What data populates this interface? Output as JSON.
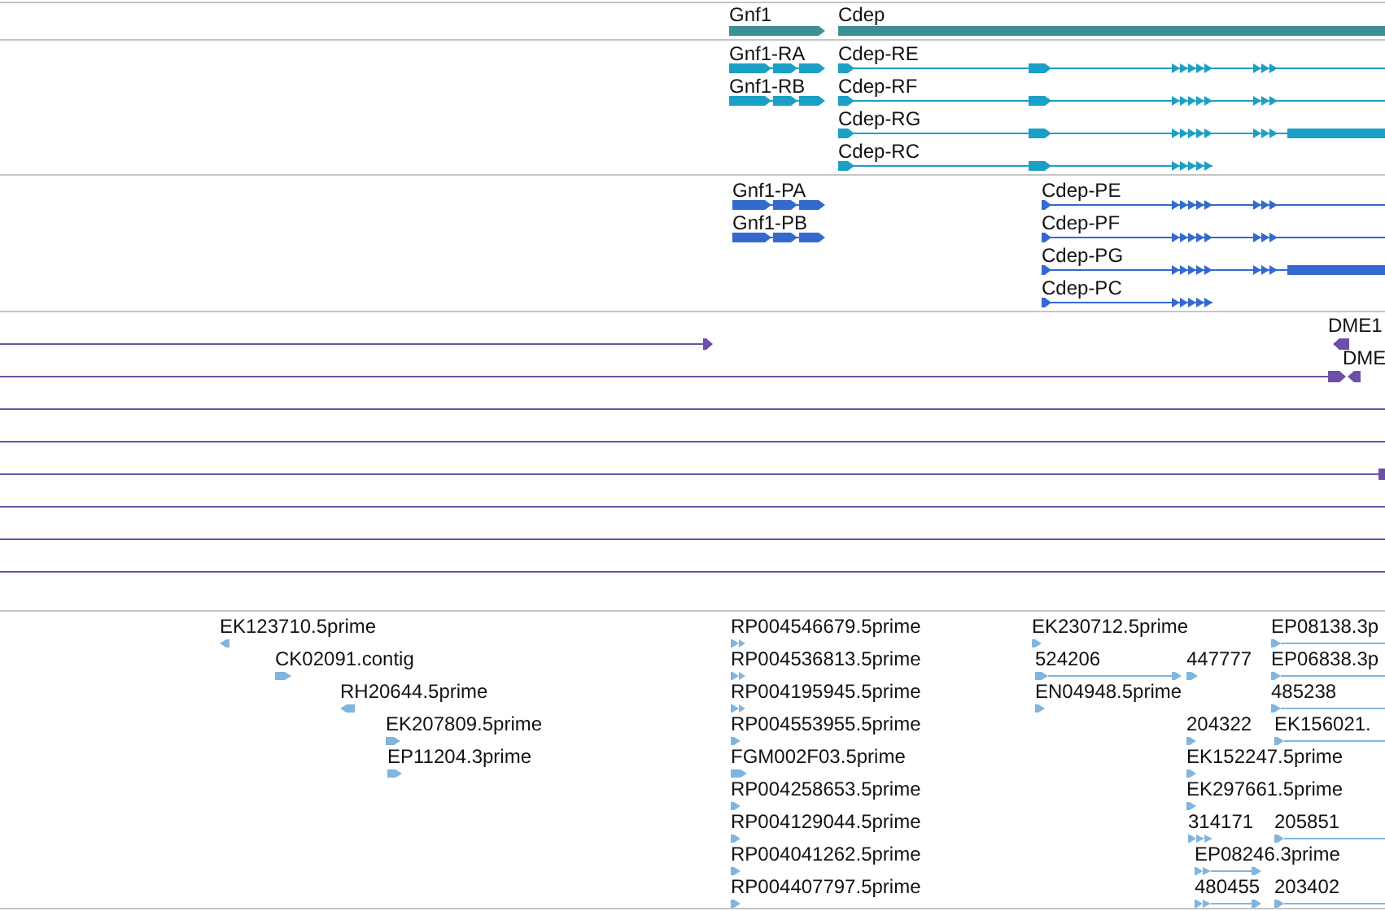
{
  "tracks": [
    {
      "kind": "gene",
      "features": [
        {
          "label": "Gnf1"
        },
        {
          "label": "Cdep"
        }
      ]
    },
    {
      "kind": "transcript",
      "features": [
        {
          "label": "Gnf1-RA"
        },
        {
          "label": "Gnf1-RB"
        },
        {
          "label": "Cdep-RE"
        },
        {
          "label": "Cdep-RF"
        },
        {
          "label": "Cdep-RG"
        },
        {
          "label": "Cdep-RC"
        }
      ]
    },
    {
      "kind": "protein",
      "features": [
        {
          "label": "Gnf1-PA"
        },
        {
          "label": "Gnf1-PB"
        },
        {
          "label": "Cdep-PE"
        },
        {
          "label": "Cdep-PF"
        },
        {
          "label": "Cdep-PG"
        },
        {
          "label": "Cdep-PC"
        }
      ]
    },
    {
      "kind": "alignment",
      "features": [
        {
          "label": "DME1"
        },
        {
          "label": "DME"
        }
      ]
    },
    {
      "kind": "est",
      "features": [
        {
          "label": "EK123710.5prime",
          "reverse": true
        },
        {
          "label": "CK02091.contig",
          "reverse": false
        },
        {
          "label": "RH20644.5prime",
          "reverse": true
        },
        {
          "label": "EK207809.5prime",
          "reverse": false
        },
        {
          "label": "EP11204.3prime",
          "reverse": false
        },
        {
          "label": "RP004546679.5prime",
          "reverse": false
        },
        {
          "label": "RP004536813.5prime",
          "reverse": false
        },
        {
          "label": "RP004195945.5prime",
          "reverse": false
        },
        {
          "label": "RP004553955.5prime",
          "reverse": false
        },
        {
          "label": "FGM002F03.5prime",
          "reverse": false
        },
        {
          "label": "RP004258653.5prime",
          "reverse": false
        },
        {
          "label": "RP004129044.5prime",
          "reverse": false
        },
        {
          "label": "RP004041262.5prime",
          "reverse": false
        },
        {
          "label": "RP004407797.5prime",
          "reverse": false
        },
        {
          "label": "EK230712.5prime",
          "reverse": false
        },
        {
          "label": "524206",
          "reverse": false
        },
        {
          "label": "447777",
          "reverse": false
        },
        {
          "label": "EN04948.5prime",
          "reverse": false
        },
        {
          "label": "EP08138.3p",
          "reverse": false
        },
        {
          "label": "EP06838.3p",
          "reverse": false
        },
        {
          "label": "485238",
          "reverse": false
        },
        {
          "label": "204322",
          "reverse": false
        },
        {
          "label": "EK156021.",
          "reverse": false
        },
        {
          "label": "EK152247.5prime",
          "reverse": false
        },
        {
          "label": "EK297661.5prime",
          "reverse": false
        },
        {
          "label": "314171",
          "reverse": false
        },
        {
          "label": "205851",
          "reverse": false
        },
        {
          "label": "EP08246.3prime",
          "reverse": false
        },
        {
          "label": "480455",
          "reverse": false
        },
        {
          "label": "203402",
          "reverse": false
        }
      ]
    }
  ]
}
